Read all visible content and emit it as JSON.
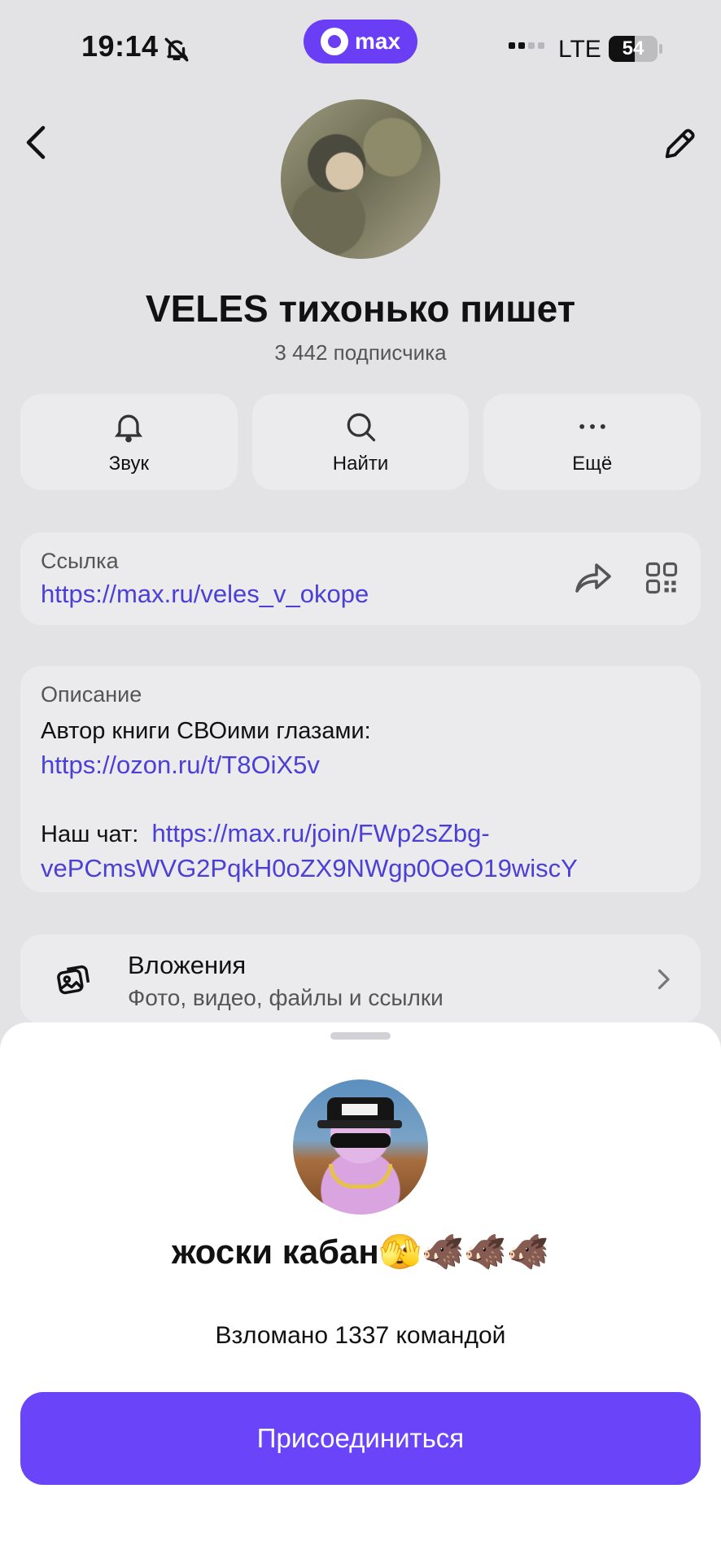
{
  "status_bar": {
    "time": "19:14",
    "app_pill": "max",
    "network": "LTE",
    "battery": "54",
    "battery_level": 0.54,
    "signal_bars_active": 2
  },
  "channel": {
    "title": "VELES тихонько пишет",
    "subscribers": "3 442 подписчика"
  },
  "actions": [
    {
      "label": "Звук",
      "icon": "bell-icon"
    },
    {
      "label": "Найти",
      "icon": "search-icon"
    },
    {
      "label": "Ещё",
      "icon": "more-icon"
    }
  ],
  "link_card": {
    "caption": "Ссылка",
    "url": "https://max.ru/veles_v_okope"
  },
  "description": {
    "caption": "Описание",
    "line1": "Автор книги СВОими глазами:",
    "link1": "https://ozon.ru/t/T8OiX5v",
    "chat_label": "Наш чат:",
    "chat_link_part1": "https://max.ru/join/FWp2sZbg-",
    "chat_link_part2": "vePCmsWVG2PqkH0oZX9NWgp0OeO19wiscY"
  },
  "attachments": {
    "title": "Вложения",
    "subtitle": "Фото, видео, файлы и ссылки"
  },
  "sheet": {
    "name": "жоски кабан🫣🐗🐗🐗",
    "description": "Взломано 1337 командой",
    "join_label": "Присоединиться"
  },
  "colors": {
    "accent": "#6a44f9",
    "link": "#4b3fd6",
    "background": "#e3e3e6",
    "card": "#ebebed"
  }
}
